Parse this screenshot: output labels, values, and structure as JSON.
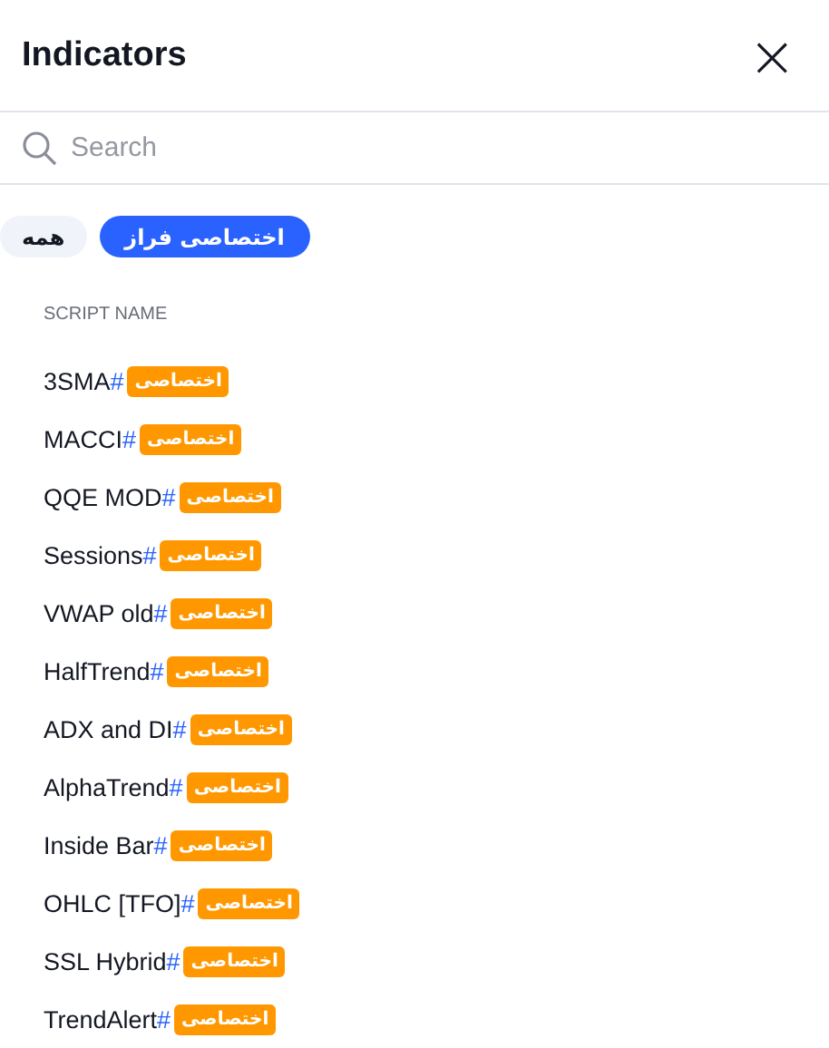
{
  "header": {
    "title": "Indicators",
    "close": "×"
  },
  "search": {
    "placeholder": "Search"
  },
  "filters": [
    {
      "label": "اختصاصی فراز",
      "selected": true
    },
    {
      "label": "همه",
      "selected": false
    }
  ],
  "list": {
    "heading": "SCRIPT NAME",
    "items": [
      {
        "name": "3SMA",
        "hash": "#",
        "badge": "اختصاصی"
      },
      {
        "name": "MACCI",
        "hash": "#",
        "badge": "اختصاصی"
      },
      {
        "name": "QQE MOD",
        "hash": "#",
        "badge": "اختصاصی"
      },
      {
        "name": "Sessions",
        "hash": "#",
        "badge": "اختصاصی"
      },
      {
        "name": "VWAP old",
        "hash": "#",
        "badge": "اختصاصی"
      },
      {
        "name": "HalfTrend",
        "hash": "#",
        "badge": "اختصاصی"
      },
      {
        "name": "ADX and DI",
        "hash": "#",
        "badge": "اختصاصی"
      },
      {
        "name": "AlphaTrend",
        "hash": "#",
        "badge": "اختصاصی"
      },
      {
        "name": "Inside Bar",
        "hash": "#",
        "badge": "اختصاصی"
      },
      {
        "name": "OHLC [TFO]",
        "hash": "#",
        "badge": "اختصاصی"
      },
      {
        "name": "SSL Hybrid",
        "hash": "#",
        "badge": "اختصاصی"
      },
      {
        "name": "TrendAlert",
        "hash": "#",
        "badge": "اختصاصی"
      }
    ]
  }
}
